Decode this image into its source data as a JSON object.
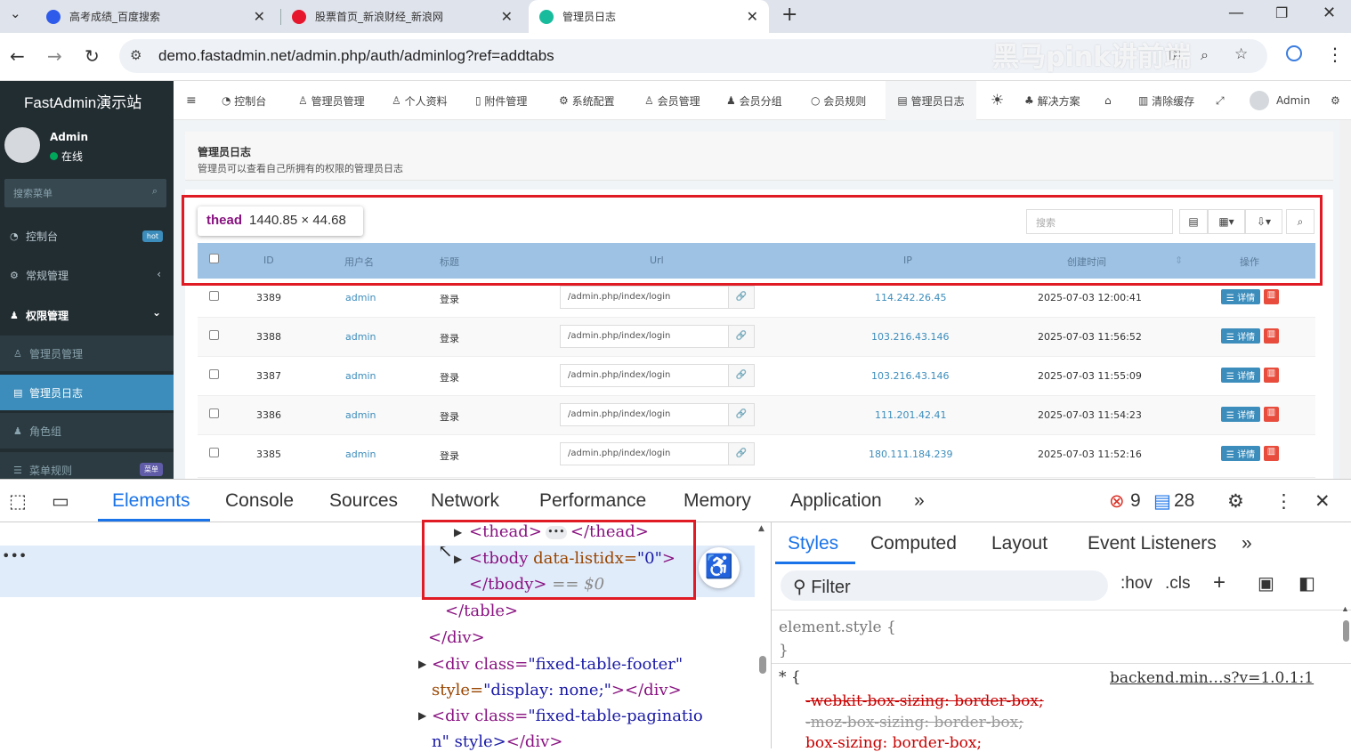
{
  "browser": {
    "tabs": [
      {
        "title": "高考成绩_百度搜索"
      },
      {
        "title": "股票首页_新浪财经_新浪网"
      },
      {
        "title": "管理员日志"
      }
    ],
    "url": "demo.fastadmin.net/admin.php/auth/adminlog?ref=addtabs",
    "new_tab": "+"
  },
  "sidebar": {
    "logo": "FastAdmin演示站",
    "user": "Admin",
    "status": "在线",
    "search_placeholder": "搜索菜单",
    "items": [
      {
        "label": "控制台",
        "badge": "hot"
      },
      {
        "label": "常规管理",
        "chevron": "‹"
      },
      {
        "label": "权限管理",
        "chevron": "⌄"
      },
      {
        "label": "管理员管理"
      },
      {
        "label": "管理员日志"
      },
      {
        "label": "角色组"
      },
      {
        "label": "菜单规则",
        "badge": "菜单"
      }
    ]
  },
  "topnav": {
    "items": [
      "控制台",
      "管理员管理",
      "个人资料",
      "附件管理",
      "系统配置",
      "会员管理",
      "会员分组",
      "会员规则",
      "管理员日志",
      "解决方案",
      "清除缓存",
      "Admin"
    ]
  },
  "panel": {
    "title": "管理员日志",
    "description": "管理员可以查看自己所拥有的权限的管理员日志",
    "search_placeholder": "搜索"
  },
  "tooltip": {
    "tag": "thead",
    "size": "1440.85 × 44.68"
  },
  "table": {
    "columns": [
      "ID",
      "用户名",
      "标题",
      "Url",
      "IP",
      "创建时间",
      "操作"
    ],
    "detail_label": "详情",
    "rows": [
      {
        "id": "3389",
        "user": "admin",
        "title": "登录",
        "url": "/admin.php/index/login",
        "ip": "114.242.26.45",
        "time": "2025-07-03 12:00:41"
      },
      {
        "id": "3388",
        "user": "admin",
        "title": "登录",
        "url": "/admin.php/index/login",
        "ip": "103.216.43.146",
        "time": "2025-07-03 11:56:52"
      },
      {
        "id": "3387",
        "user": "admin",
        "title": "登录",
        "url": "/admin.php/index/login",
        "ip": "103.216.43.146",
        "time": "2025-07-03 11:55:09"
      },
      {
        "id": "3386",
        "user": "admin",
        "title": "登录",
        "url": "/admin.php/index/login",
        "ip": "111.201.42.41",
        "time": "2025-07-03 11:54:23"
      },
      {
        "id": "3385",
        "user": "admin",
        "title": "登录",
        "url": "/admin.php/index/login",
        "ip": "180.111.184.239",
        "time": "2025-07-03 11:52:16"
      }
    ]
  },
  "devtools": {
    "tabs": [
      "Elements",
      "Console",
      "Sources",
      "Network",
      "Performance",
      "Memory",
      "Application"
    ],
    "errors": "9",
    "messages": "28",
    "styles_tabs": [
      "Styles",
      "Computed",
      "Layout",
      "Event Listeners"
    ],
    "filter_placeholder": "Filter",
    "hov": ":hov",
    "cls": ".cls",
    "element_style": "element.style {",
    "close_brace": "}",
    "star_rule": "* {",
    "source_link": "backend.min…s?v=1.0.1:1",
    "props": [
      "-webkit-box-sizing: border-box;",
      "-moz-box-sizing: border-box;",
      "box-sizing: border-box;"
    ],
    "dom": {
      "thead_open": "<thead>",
      "thead_close": "</thead>",
      "tbody_open": "<tbody",
      "tbody_attr": " data-listidx=",
      "tbody_val": "\"0\"",
      "tbody_gt": ">",
      "tbody_close": "</tbody>",
      "dollar": "== $0",
      "table_close": "</table>",
      "div_close": "</div>",
      "div_footer_1": "<div class=",
      "div_footer_val": "\"fixed-table-footer\"",
      "div_footer_2": "style=",
      "div_footer_style": "\"display: none;\"",
      "div_footer_3": "></div>",
      "div_pag_1": "<div class=",
      "div_pag_val": "\"fixed-table-paginatio",
      "div_pag_2": "n\" style>",
      "div_pag_3": "</div>"
    }
  },
  "watermark": "黑马pink讲前端"
}
